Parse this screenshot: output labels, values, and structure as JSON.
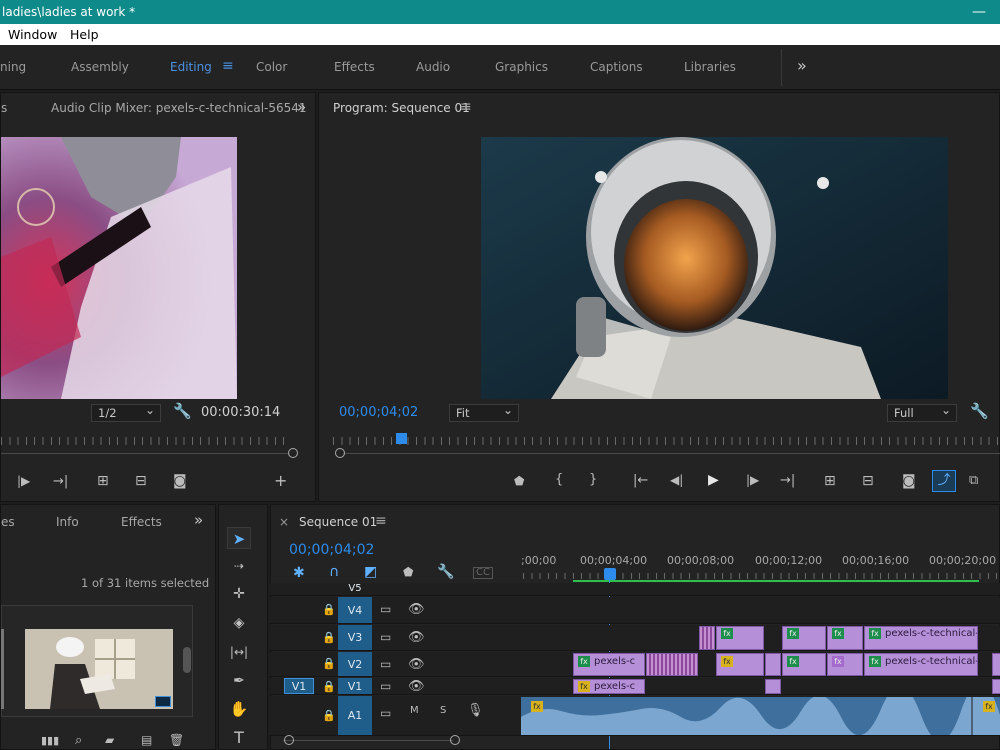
{
  "app": {
    "title": "ladies\\ladies at work *"
  },
  "menu": [
    "Window",
    "Help"
  ],
  "workspaces": {
    "items": [
      "ning",
      "Assembly",
      "Editing",
      "Color",
      "Effects",
      "Audio",
      "Graphics",
      "Captions",
      "Libraries"
    ],
    "active": "Editing",
    "more": "»",
    "editing_menu": "≡"
  },
  "source_panel": {
    "tab_prefix": "s",
    "tab_label": "Audio Clip Mixer: pexels-c-technical-56541",
    "more": "»",
    "resolution": "1/2",
    "timecode": "00:00:30:14"
  },
  "program_panel": {
    "tab_label": "Program: Sequence 01",
    "menu": "≡",
    "timecode": "00;00;04;02",
    "fit": "Fit",
    "quality": "Full",
    "playhead_fraction": 0.09
  },
  "project_panel": {
    "tabs": [
      "es",
      "Info",
      "Effects"
    ],
    "more": "»",
    "selection": "1 of 31 items selected"
  },
  "timeline": {
    "close": "×",
    "tab_label": "Sequence 01",
    "menu": "≡",
    "timecode": "00;00;04;02",
    "ruler": [
      ";00;00",
      "00;00;04;00",
      "00;00;08;00",
      "00;00;12;00",
      "00;00;16;00",
      "00;00;20;00"
    ],
    "tracks": {
      "v5": "V5",
      "v4": "V4",
      "v3": "V3",
      "v2": "V2",
      "v1": "V1",
      "v1_source": "V1",
      "a1": "A1",
      "a1_m": "M",
      "a1_s": "S"
    },
    "clips": {
      "v3_label": "pexels-c-technical-",
      "v2_first": "pexels-c",
      "v2_last": "pexels-c-technical-",
      "v1_first": "pexels-c"
    },
    "fx": "fx"
  },
  "icons": [
    "play-icon",
    "wrench-icon",
    "camera-icon",
    "snap-magnet-icon",
    "lock-icon",
    "eye-icon",
    "mic-icon",
    "selection-tool-icon",
    "type-tool-icon",
    "hand-tool-icon",
    "pen-tool-icon",
    "razor-tool-icon"
  ]
}
